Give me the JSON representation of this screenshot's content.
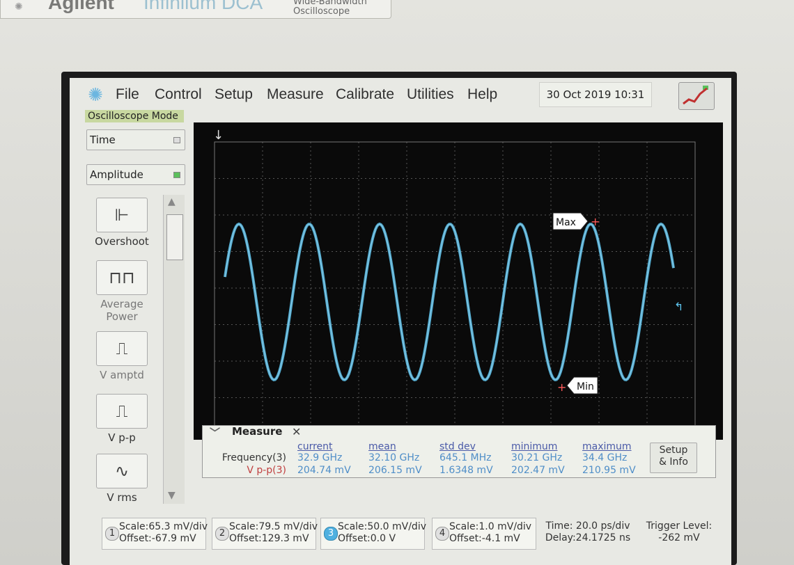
{
  "header": {
    "brand": "Agilent",
    "product": "Infiniium DCA",
    "subtitle_line1": "Wide-Bandwidth",
    "subtitle_line2": "Oscilloscope"
  },
  "menu": {
    "items": [
      "File",
      "Control",
      "Setup",
      "Measure",
      "Calibrate",
      "Utilities",
      "Help"
    ],
    "datetime": "30 Oct 2019  10:31"
  },
  "mode": {
    "badge": "Oscilloscope Mode",
    "select1": "Time",
    "select2": "Amplitude"
  },
  "tools": [
    {
      "label": "Overshoot"
    },
    {
      "label": "Average Power"
    },
    {
      "label": "V amptd"
    },
    {
      "label": "V p-p"
    },
    {
      "label": "V rms"
    }
  ],
  "plot_markers": {
    "max_label": "Max",
    "min_label": "Min"
  },
  "measure": {
    "tab": "Measure",
    "headers": [
      "current",
      "mean",
      "std dev",
      "minimum",
      "maximum"
    ],
    "rows": [
      {
        "label": "Frequency(3)",
        "values": [
          "32.9 GHz",
          "32.10 GHz",
          "645.1 MHz",
          "30.21 GHz",
          "34.4 GHz"
        ]
      },
      {
        "label": "V p-p(3)",
        "values": [
          "204.74 mV",
          "206.15 mV",
          "1.6348 mV",
          "202.47 mV",
          "210.95 mV"
        ]
      }
    ],
    "setup_button_line1": "Setup",
    "setup_button_line2": "& Info"
  },
  "channels": [
    {
      "num": "1",
      "scale": "Scale:65.3 mV/div",
      "offset": "Offset:-67.9 mV"
    },
    {
      "num": "2",
      "scale": "Scale:79.5 mV/div",
      "offset": "Offset:129.3 mV"
    },
    {
      "num": "3",
      "scale": "Scale:50.0 mV/div",
      "offset": "Offset:0.0 V"
    },
    {
      "num": "4",
      "scale": "Scale:1.0 mV/div",
      "offset": "Offset:-4.1 mV"
    }
  ],
  "timebase": {
    "time": "Time: 20.0 ps/div",
    "delay": "Delay:24.1725 ns"
  },
  "trigger": {
    "label": "Trigger Level:",
    "value": "-262 mV"
  },
  "colors": {
    "trace": "#5ec6f0",
    "screen_bg": "#0a0a0a",
    "grid": "#555555",
    "marker": "#ff5a5a"
  }
}
